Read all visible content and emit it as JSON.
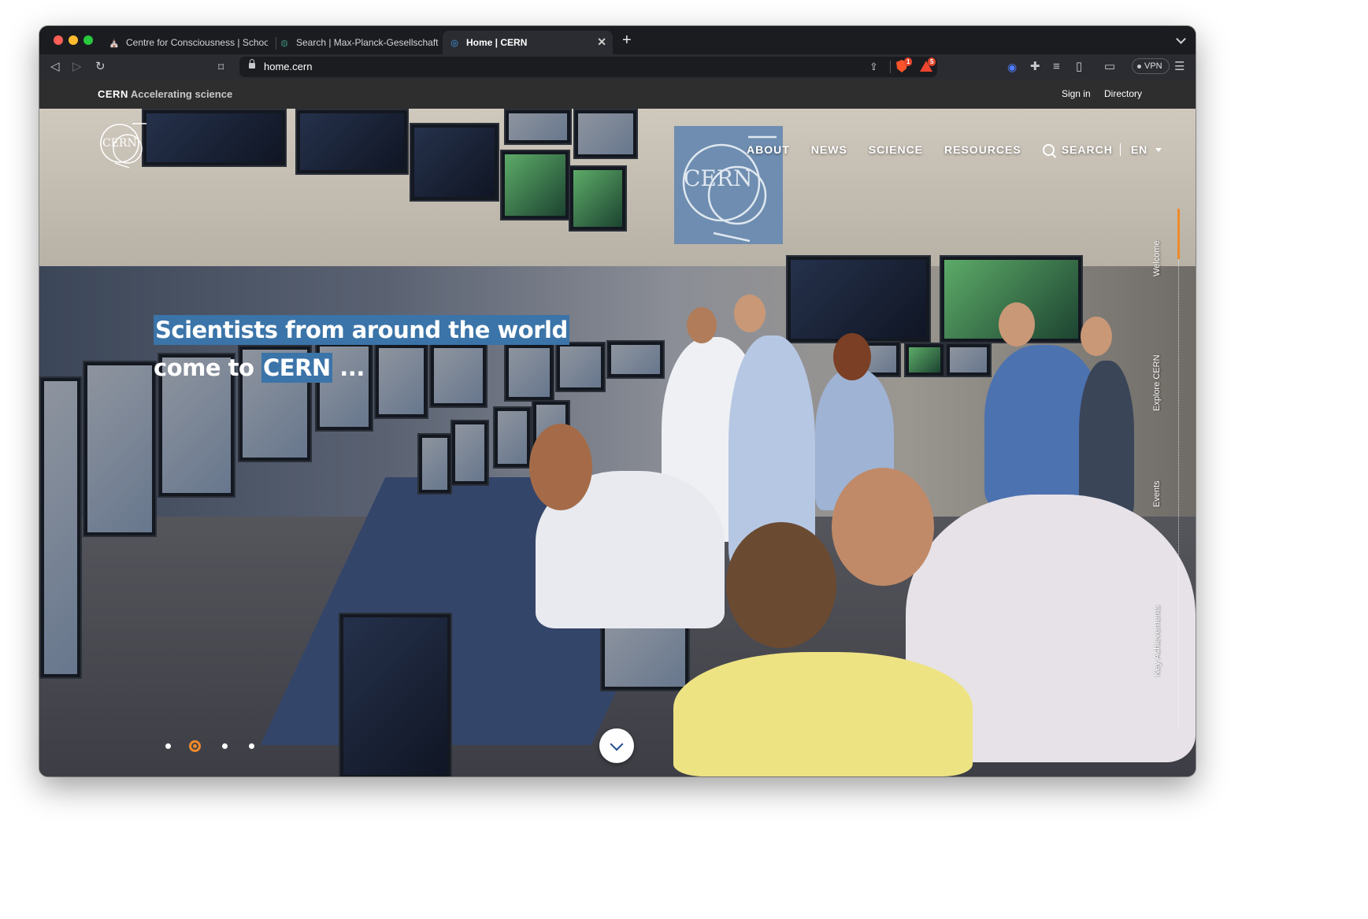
{
  "browser": {
    "tabs": [
      {
        "title": "Centre for Consciousness | School of",
        "favicon": "crest-icon"
      },
      {
        "title": "Search | Max-Planck-Gesellschaft",
        "favicon": "mpg-icon"
      },
      {
        "title": "Home | CERN",
        "favicon": "cern-icon",
        "active": true
      }
    ],
    "new_tab": "+",
    "url": "home.cern",
    "shields_badge": "1",
    "rewards_badge": "5",
    "vpn_label": "VPN"
  },
  "site": {
    "brand_name": "CERN",
    "brand_tagline": "Accelerating science",
    "top_links": [
      "Sign in",
      "Directory"
    ],
    "logo_text": "CERN",
    "banner_text": "CERN",
    "nav": {
      "about": "ABOUT",
      "news": "NEWS",
      "science": "SCIENCE",
      "resources": "RESOURCES",
      "search": "SEARCH",
      "language": "EN"
    },
    "headline": {
      "line1": "Scientists from around the world",
      "line2_prefix": "come to ",
      "line2_highlight": "CERN",
      "line2_suffix": " ..."
    },
    "side_sections": [
      "Welcome",
      "Explore CERN",
      "Events",
      "Key Achievements"
    ],
    "active_section": "Welcome",
    "carousel": {
      "count": 4,
      "active": 2
    },
    "colors": {
      "accent_orange": "#f08a28",
      "highlight_blue": "#3b74a8",
      "topbar": "#2e2e2e"
    }
  }
}
